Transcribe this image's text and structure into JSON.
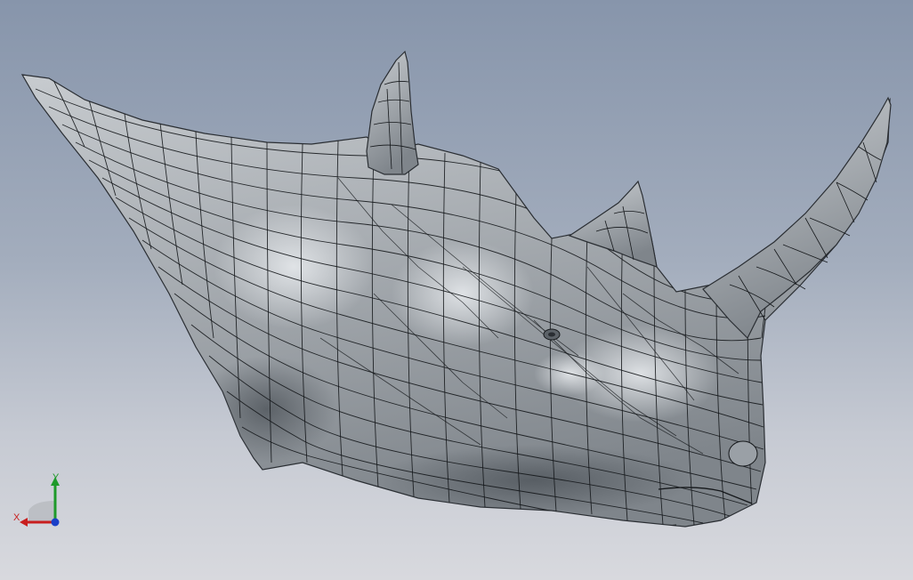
{
  "viewport": {
    "background_top": "#8795ab",
    "background_bottom": "#d8d9de"
  },
  "model": {
    "subject": "rhino-head-surface-mesh",
    "surface_color": "#a9aeb3",
    "edge_color": "#1b1d20"
  },
  "triad": {
    "x_label": "X",
    "y_label": "Y",
    "x_color": "#c81e1e",
    "y_color": "#1e9a2a",
    "z_color": "#1a3fc8"
  }
}
